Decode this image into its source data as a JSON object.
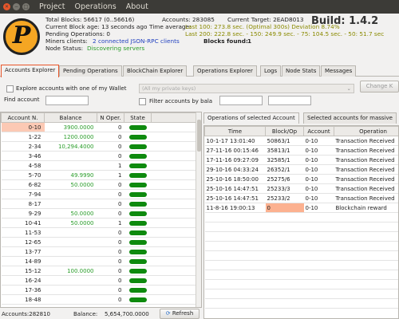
{
  "menu": {
    "items": [
      "Project",
      "Operations",
      "About"
    ]
  },
  "info": {
    "total_blocks": "Total Blocks:  56617 (0..56616)",
    "accounts": "Accounts: 283085",
    "current_target": "Current Target: 2EAD8013",
    "block_age": "Current Block age: 13 seconds ago",
    "time_average_label": "Time average:",
    "time_average_value": "Last 100: 273.8 sec. (Optimal 300s) Deviation 8.74%",
    "last_history": "Last 200: 222.8 sec. - 150: 249.9 sec. - 75: 104.5 sec. - 50: 51.7 sec",
    "pending_ops": "Pending Operations: 0",
    "miners_label": "Miners clients:",
    "miners_value": "2 connected JSON-RPC clients",
    "blocks_found_label": "Blocks found:",
    "blocks_found_value": "1",
    "node_status_label": "Node Status:",
    "node_status_value": "Discovering servers",
    "build": "Build: 1.4.2",
    "logo_letter": "P"
  },
  "tabs": [
    "Accounts Explorer",
    "Pending Operations",
    "BlockChain Explorer",
    "Operations Explorer",
    "Logs",
    "Node Stats",
    "Messages"
  ],
  "filters": {
    "explore_label": "Explore accounts with one of my Wallet",
    "private_keys_placeholder": "(All my private keys)",
    "change_key_button": "Change K",
    "find_account_label": "Find account",
    "filter_label": "Filter accounts by bala"
  },
  "accounts_table": {
    "headers": [
      "Account N.",
      "Balance",
      "N Oper.",
      "State"
    ],
    "rows": [
      {
        "account": "0-10",
        "balance": "3900.0000",
        "nop": "0"
      },
      {
        "account": "1-22",
        "balance": "1200.0000",
        "nop": "0"
      },
      {
        "account": "2-34",
        "balance": "10,294.4000",
        "nop": "0"
      },
      {
        "account": "3-46",
        "balance": "",
        "nop": "0"
      },
      {
        "account": "4-58",
        "balance": "",
        "nop": "1"
      },
      {
        "account": "5-70",
        "balance": "49.9990",
        "nop": "1"
      },
      {
        "account": "6-82",
        "balance": "50.0000",
        "nop": "0"
      },
      {
        "account": "7-94",
        "balance": "",
        "nop": "0"
      },
      {
        "account": "8-17",
        "balance": "",
        "nop": "0"
      },
      {
        "account": "9-29",
        "balance": "50.0000",
        "nop": "0"
      },
      {
        "account": "10-41",
        "balance": "50.0000",
        "nop": "1"
      },
      {
        "account": "11-53",
        "balance": "",
        "nop": "0"
      },
      {
        "account": "12-65",
        "balance": "",
        "nop": "0"
      },
      {
        "account": "13-77",
        "balance": "",
        "nop": "0"
      },
      {
        "account": "14-89",
        "balance": "",
        "nop": "0"
      },
      {
        "account": "15-12",
        "balance": "100.0000",
        "nop": "0"
      },
      {
        "account": "16-24",
        "balance": "",
        "nop": "0"
      },
      {
        "account": "17-36",
        "balance": "",
        "nop": "0"
      },
      {
        "account": "18-48",
        "balance": "",
        "nop": "0"
      }
    ]
  },
  "footer": {
    "accounts": "Accounts:282810",
    "balance_label": "Balance:",
    "balance_value": "5,654,700.0000",
    "refresh_button": "Refresh"
  },
  "operations": {
    "tabs": [
      "Operations of selected Account",
      "Selected accounts for massive"
    ],
    "headers": [
      "Time",
      "Block/Op",
      "Account",
      "Operation"
    ],
    "rows": [
      {
        "time": "10-1-17 13:01:40",
        "block": "50863/1",
        "account": "0-10",
        "op": "Transaction Received"
      },
      {
        "time": "27-11-16 00:15:46",
        "block": "35813/1",
        "account": "0-10",
        "op": "Transaction Received"
      },
      {
        "time": "17-11-16 09:27:09",
        "block": "32585/1",
        "account": "0-10",
        "op": "Transaction Received"
      },
      {
        "time": "29-10-16 04:33:24",
        "block": "26352/1",
        "account": "0-10",
        "op": "Transaction Received"
      },
      {
        "time": "25-10-16 18:50:00",
        "block": "25275/6",
        "account": "0-10",
        "op": "Transaction Received"
      },
      {
        "time": "25-10-16 14:47:51",
        "block": "25233/3",
        "account": "0-10",
        "op": "Transaction Received"
      },
      {
        "time": "25-10-16 14:47:51",
        "block": "25233/2",
        "account": "0-10",
        "op": "Transaction Received"
      },
      {
        "time": "11-8-16 19:00:13",
        "block": "0",
        "account": "0-10",
        "op": "Blockchain reward"
      }
    ]
  },
  "colors": {
    "balance_green": "#2a9d2a",
    "state_green": "#0e8a0e",
    "selection": "#fcc9b4"
  },
  "icons": {
    "window_close": "close-icon",
    "window_minimize": "minimize-icon",
    "window_maximize": "maximize-icon",
    "refresh": "refresh-icon",
    "dropdown": "chevron-down-icon"
  }
}
